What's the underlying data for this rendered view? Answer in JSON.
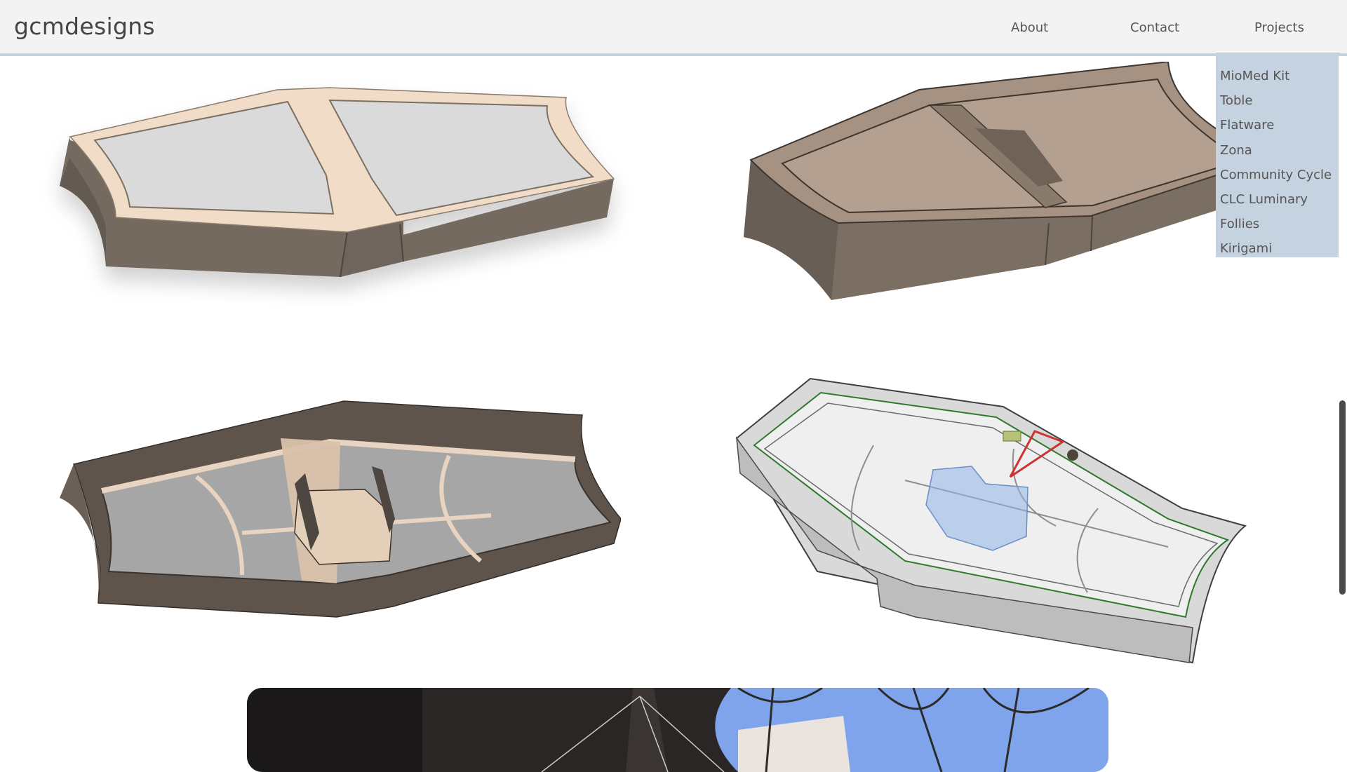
{
  "site": {
    "logo": "gcmdesigns"
  },
  "nav": {
    "about": "About",
    "contact": "Contact",
    "projects": "Projects"
  },
  "dropdown": {
    "items": [
      "MioMed Kit",
      "Toble",
      "Flatware",
      "Zona",
      "Community Cycle",
      "CLC Luminary",
      "Follies",
      "Kirigami"
    ]
  },
  "images": [
    {
      "name": "plywood-tray-top-view",
      "icon": "cad-render"
    },
    {
      "name": "wood-tray-lid-view",
      "icon": "cad-render"
    },
    {
      "name": "tray-interior-dividers-view",
      "icon": "cad-render"
    },
    {
      "name": "transparent-wireframe-view",
      "icon": "cad-render"
    },
    {
      "name": "tree-photo",
      "icon": "photo"
    }
  ],
  "colors": {
    "header_bg": "#f3f3f3",
    "accent": "#c4d3df",
    "text": "#555555",
    "wood_light": "#f0d9c4",
    "wood_dark": "#7a6c60"
  }
}
